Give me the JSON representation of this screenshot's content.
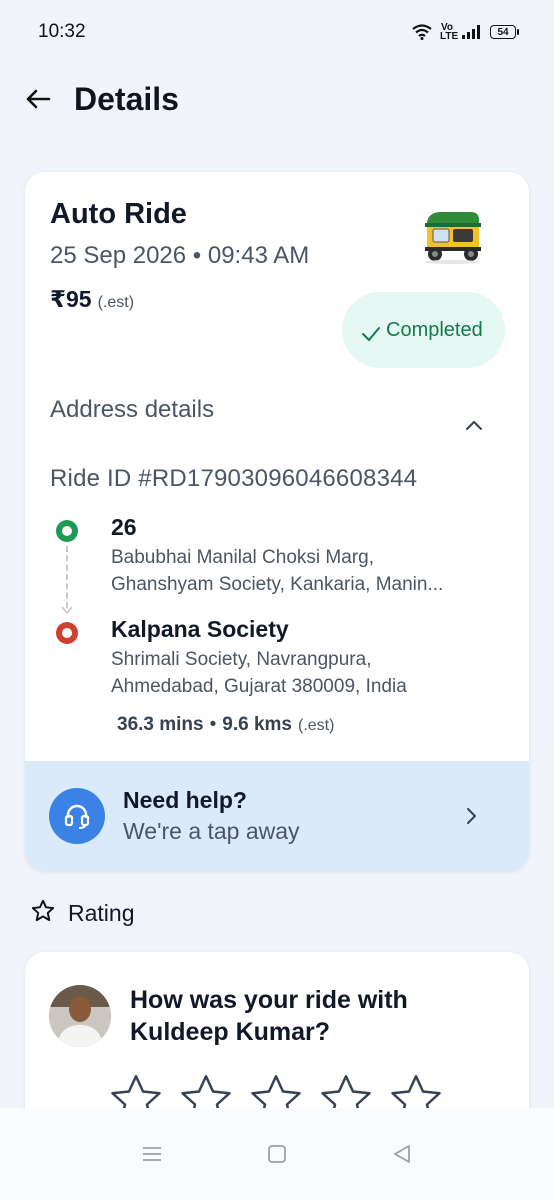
{
  "status_bar": {
    "time": "10:32",
    "volte": "Vo LTE",
    "battery": "54"
  },
  "header": {
    "title": "Details"
  },
  "ride": {
    "title": "Auto Ride",
    "datetime": "25 Sep 2026 • 09:43 AM",
    "fare": "₹95",
    "fare_note": "(.est)",
    "status": "Completed"
  },
  "address": {
    "header": "Address details",
    "ride_id": "Ride ID #RD17903096046608344",
    "pickup": {
      "title": "26",
      "line1": "Babubhai Manilal Choksi Marg,",
      "line2": "Ghanshyam Society, Kankaria, Manin..."
    },
    "drop": {
      "title": "Kalpana Society",
      "line1": "Shrimali Society, Navrangpura,",
      "line2": "Ahmedabad, Gujarat 380009, India"
    },
    "duration": "36.3 mins",
    "distance": "9.6 kms",
    "trip_note": "(.est)"
  },
  "help": {
    "title": "Need help?",
    "subtitle": "We're a tap away"
  },
  "rating": {
    "label": "Rating",
    "question": "How was your ride with Kuldeep Kumar?",
    "stars": 5
  },
  "colors": {
    "status_green": "#137a4a",
    "status_bg": "#e6f8f3",
    "pickup": "#1e9a55",
    "drop": "#d0402e",
    "help_bg": "#dbeafb",
    "accent_blue": "#3b82e6"
  }
}
